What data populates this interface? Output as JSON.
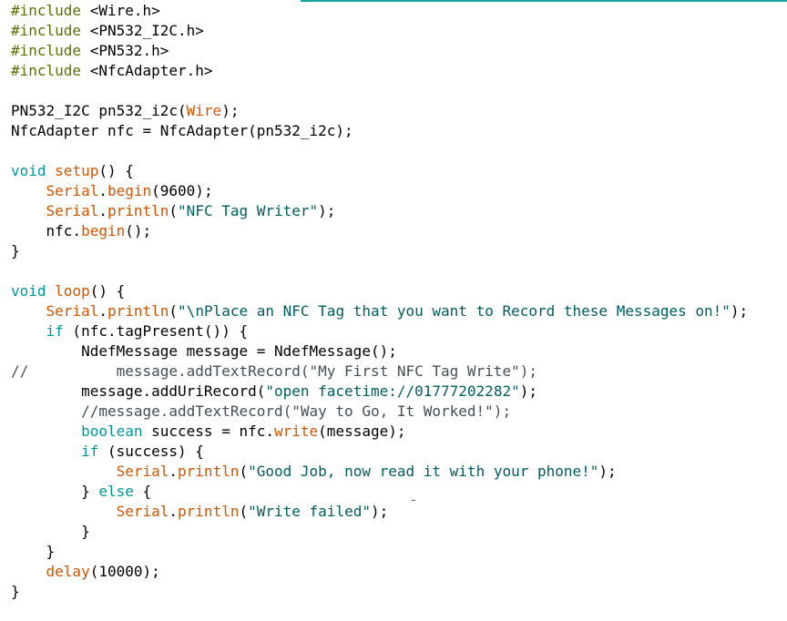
{
  "editor": {
    "lines": [
      [
        {
          "t": "#include",
          "c": "inc"
        },
        {
          "t": " <Wire.h>",
          "c": "plain"
        }
      ],
      [
        {
          "t": "#include",
          "c": "inc"
        },
        {
          "t": " <PN532_I2C.h>",
          "c": "plain"
        }
      ],
      [
        {
          "t": "#include",
          "c": "inc"
        },
        {
          "t": " <PN532.h>",
          "c": "plain"
        }
      ],
      [
        {
          "t": "#include",
          "c": "inc"
        },
        {
          "t": " <NfcAdapter.h>",
          "c": "plain"
        }
      ],
      [],
      [
        {
          "t": "PN532_I2C pn532_i2c(",
          "c": "plain"
        },
        {
          "t": "Wire",
          "c": "fn"
        },
        {
          "t": ");",
          "c": "plain"
        }
      ],
      [
        {
          "t": "NfcAdapter nfc = NfcAdapter(pn532_i2c);",
          "c": "plain"
        }
      ],
      [],
      [
        {
          "t": "void",
          "c": "kw"
        },
        {
          "t": " ",
          "c": "plain"
        },
        {
          "t": "setup",
          "c": "fn"
        },
        {
          "t": "() {",
          "c": "plain"
        }
      ],
      [
        {
          "t": "    ",
          "c": "plain"
        },
        {
          "t": "Serial",
          "c": "fn"
        },
        {
          "t": ".",
          "c": "plain"
        },
        {
          "t": "begin",
          "c": "fn"
        },
        {
          "t": "(9600);",
          "c": "plain"
        }
      ],
      [
        {
          "t": "    ",
          "c": "plain"
        },
        {
          "t": "Serial",
          "c": "fn"
        },
        {
          "t": ".",
          "c": "plain"
        },
        {
          "t": "println",
          "c": "fn"
        },
        {
          "t": "(",
          "c": "plain"
        },
        {
          "t": "\"NFC Tag Writer\"",
          "c": "str"
        },
        {
          "t": ");",
          "c": "plain"
        }
      ],
      [
        {
          "t": "    nfc.",
          "c": "plain"
        },
        {
          "t": "begin",
          "c": "fn"
        },
        {
          "t": "();",
          "c": "plain"
        }
      ],
      [
        {
          "t": "}",
          "c": "plain"
        }
      ],
      [],
      [
        {
          "t": "void",
          "c": "kw"
        },
        {
          "t": " ",
          "c": "plain"
        },
        {
          "t": "loop",
          "c": "fn"
        },
        {
          "t": "() {",
          "c": "plain"
        }
      ],
      [
        {
          "t": "    ",
          "c": "plain"
        },
        {
          "t": "Serial",
          "c": "fn"
        },
        {
          "t": ".",
          "c": "plain"
        },
        {
          "t": "println",
          "c": "fn"
        },
        {
          "t": "(",
          "c": "plain"
        },
        {
          "t": "\"\\nPlace an NFC Tag that you want to Record these Messages on!\"",
          "c": "str"
        },
        {
          "t": ");",
          "c": "plain"
        }
      ],
      [
        {
          "t": "    ",
          "c": "plain"
        },
        {
          "t": "if",
          "c": "kw"
        },
        {
          "t": " (nfc.tagPresent()) {",
          "c": "plain"
        }
      ],
      [
        {
          "t": "        NdefMessage message = NdefMessage();",
          "c": "plain"
        }
      ],
      [
        {
          "t": "//          message.addTextRecord(\"My First NFC Tag Write\");",
          "c": "cmt"
        }
      ],
      [
        {
          "t": "        message.addUriRecord(",
          "c": "plain"
        },
        {
          "t": "\"open facetime://01777202282\"",
          "c": "str"
        },
        {
          "t": ");",
          "c": "plain"
        }
      ],
      [
        {
          "t": "        ",
          "c": "plain"
        },
        {
          "t": "//message.addTextRecord(\"Way to Go, It Worked!\");",
          "c": "cmt"
        }
      ],
      [
        {
          "t": "        ",
          "c": "plain"
        },
        {
          "t": "boolean",
          "c": "kw"
        },
        {
          "t": " success = nfc.",
          "c": "plain"
        },
        {
          "t": "write",
          "c": "fn"
        },
        {
          "t": "(message);",
          "c": "plain"
        }
      ],
      [
        {
          "t": "        ",
          "c": "plain"
        },
        {
          "t": "if",
          "c": "kw"
        },
        {
          "t": " (success) {",
          "c": "plain"
        }
      ],
      [
        {
          "t": "            ",
          "c": "plain"
        },
        {
          "t": "Serial",
          "c": "fn"
        },
        {
          "t": ".",
          "c": "plain"
        },
        {
          "t": "println",
          "c": "fn"
        },
        {
          "t": "(",
          "c": "plain"
        },
        {
          "t": "\"Good Job, now read it with your phone!\"",
          "c": "str"
        },
        {
          "t": ");",
          "c": "plain"
        }
      ],
      [
        {
          "t": "        } ",
          "c": "plain"
        },
        {
          "t": "else",
          "c": "kw"
        },
        {
          "t": " {",
          "c": "plain"
        }
      ],
      [
        {
          "t": "            ",
          "c": "plain"
        },
        {
          "t": "Serial",
          "c": "fn"
        },
        {
          "t": ".",
          "c": "plain"
        },
        {
          "t": "println",
          "c": "fn"
        },
        {
          "t": "(",
          "c": "plain"
        },
        {
          "t": "\"Write failed\"",
          "c": "str"
        },
        {
          "t": ");",
          "c": "plain"
        }
      ],
      [
        {
          "t": "        }",
          "c": "plain"
        }
      ],
      [
        {
          "t": "    }",
          "c": "plain"
        }
      ],
      [
        {
          "t": "    ",
          "c": "plain"
        },
        {
          "t": "delay",
          "c": "fn"
        },
        {
          "t": "(10000);",
          "c": "plain"
        }
      ],
      [
        {
          "t": "}",
          "c": "plain"
        }
      ]
    ]
  },
  "colors": {
    "keyword": "#00979c",
    "function": "#d35400",
    "string": "#005c5f",
    "preprocessor": "#5e6d03",
    "comment": "#434f54",
    "accent": "#17a1a5"
  }
}
